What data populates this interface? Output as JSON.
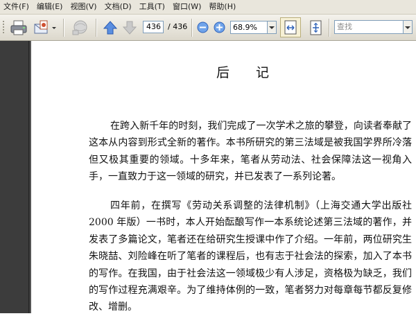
{
  "menu": {
    "file": "文件(F)",
    "edit": "编辑(E)",
    "view": "视图(V)",
    "document": "文档(D)",
    "tools": "工具(T)",
    "window": "窗口(W)",
    "help": "帮助(H)"
  },
  "toolbar": {
    "current_page": "436",
    "total_pages": "/ 436",
    "zoom": "68.9%",
    "search_placeholder": "查找"
  },
  "document": {
    "title": "后记",
    "paragraphs": [
      "在跨入新千年的时刻，我们完成了一次学术之旅的攀登，向读者奉献了这本从内容到形式全新的著作。本书所研究的第三法域是被我国学界所冷落但又极其重要的领域。十多年来，笔者从劳动法、社会保障法这一视角入手，一直致力于这一领域的研究，并已发表了一系列论著。",
      "四年前，在撰写《劳动关系调整的法律机制》（上海交通大学出版社 2000 年版）一书时，本人开始酝酿写作一本系统论述第三法域的著作，并发表了多篇论文，笔者还在给研究生授课中作了介绍。一年前，两位研究生朱晓喆、刘险峰在听了笔者的课程后，也有志于社会法的探索，加入了本书的写作。在我国，由于社会法这一领域极少有人涉足，资格极为缺乏，我们的写作过程充满艰辛。为了维持体例的一致，笔者努力对每章每节都反复修改、增删。"
    ]
  }
}
